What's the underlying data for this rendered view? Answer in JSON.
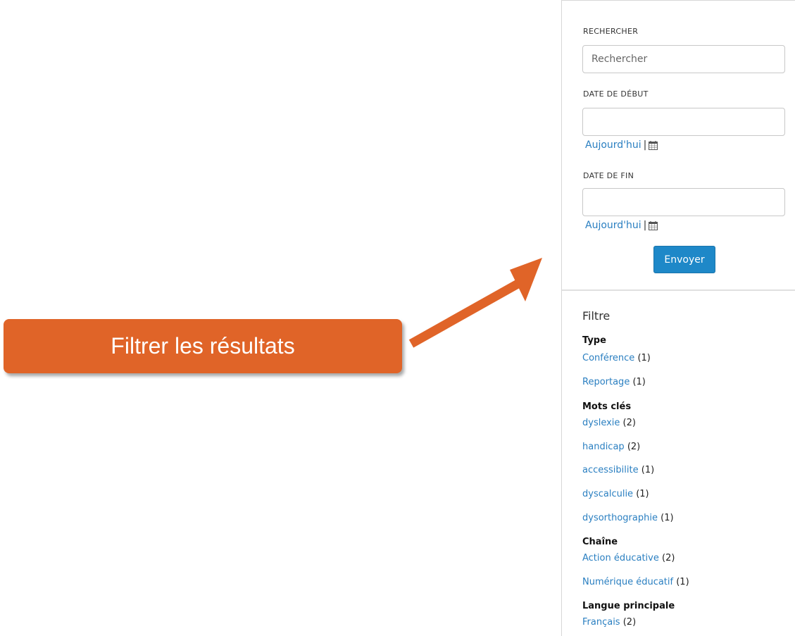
{
  "callout": {
    "text": "Filtrer les résultats",
    "color": "#e06428"
  },
  "search": {
    "search_label": "Rechercher",
    "search_placeholder": "Rechercher",
    "start_label": "Date de début",
    "start_value": "",
    "start_today": "Aujourd'hui",
    "end_label": "Date de fin",
    "end_value": "",
    "end_today": "Aujourd'hui",
    "separator": "|",
    "submit_label": "Envoyer",
    "accent_color": "#1e88c8"
  },
  "filters": {
    "title": "Filtre",
    "groups": [
      {
        "heading": "Type",
        "items": [
          {
            "label": "Conférence",
            "count": "(1)"
          },
          {
            "label": "Reportage",
            "count": "(1)"
          }
        ]
      },
      {
        "heading": "Mots clés",
        "items": [
          {
            "label": "dyslexie",
            "count": "(2)"
          },
          {
            "label": "handicap",
            "count": "(2)"
          },
          {
            "label": "accessibilite",
            "count": "(1)"
          },
          {
            "label": "dyscalculie",
            "count": "(1)"
          },
          {
            "label": "dysorthographie",
            "count": "(1)"
          }
        ]
      },
      {
        "heading": "Chaîne",
        "items": [
          {
            "label": "Action éducative",
            "count": "(2)"
          },
          {
            "label": "Numérique éducatif",
            "count": "(1)"
          }
        ]
      },
      {
        "heading": "Langue principale",
        "items": [
          {
            "label": "Français",
            "count": "(2)"
          }
        ]
      }
    ]
  },
  "link_color": "#2a7fc1"
}
